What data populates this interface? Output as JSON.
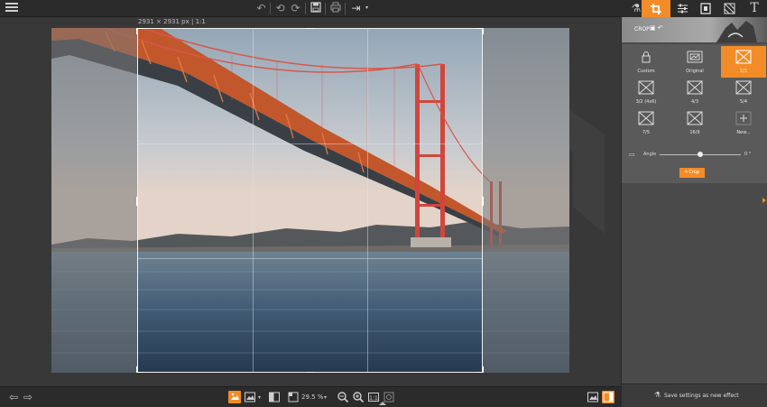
{
  "toolbar": {
    "icons": [
      "menu-icon",
      "undo-all-icon",
      "undo-icon",
      "redo-icon",
      "save-icon",
      "print-icon",
      "export-icon"
    ]
  },
  "canvas": {
    "dimensions_label": "2931 × 2931 px | 1:1"
  },
  "bottom": {
    "zoom_value": "29.5 %"
  },
  "panel": {
    "tabs": [
      "flask-icon",
      "crop-icon",
      "adjust-icon",
      "frame-icon",
      "texture-icon",
      "text-icon"
    ],
    "active_tab": "crop-icon",
    "crop_title": "CROP",
    "presets": [
      {
        "label": "Custom",
        "icon": "lock-icon"
      },
      {
        "label": "Original",
        "icon": "image-icon"
      },
      {
        "label": "1/1",
        "icon": "ratio-icon",
        "selected": true
      },
      {
        "label": "3/2 (4x6)",
        "icon": "ratio-icon"
      },
      {
        "label": "4/3",
        "icon": "ratio-icon"
      },
      {
        "label": "5/4",
        "icon": "ratio-icon"
      },
      {
        "label": "7/5",
        "icon": "ratio-icon"
      },
      {
        "label": "16/9",
        "icon": "ratio-icon"
      },
      {
        "label": "New...",
        "icon": "plus-icon"
      }
    ],
    "angle_label": "Angle",
    "angle_value": "0 °",
    "angle_fraction": 0.5,
    "crop_button": "Crop",
    "save_effect_label": "Save settings as new effect"
  },
  "colors": {
    "accent": "#f28c28",
    "panel_bg": "#4a4a4a",
    "toolbar_bg": "#2b2b2b"
  }
}
